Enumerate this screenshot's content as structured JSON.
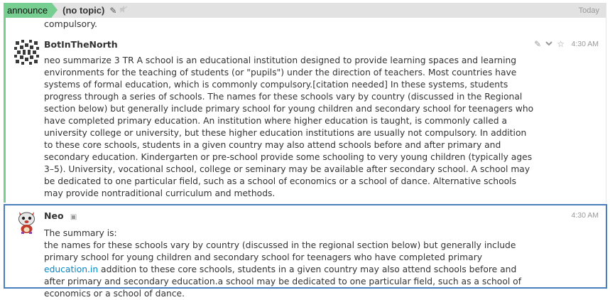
{
  "recipient": {
    "stream": "announce",
    "topic": "(no topic)",
    "date": "Today"
  },
  "messages": [
    {
      "continuation_text": "compulsory."
    },
    {
      "sender": "BotInTheNorth",
      "time": "4:30 AM",
      "body": "neo summarize 3 TR A school is an educational institution designed to provide learning spaces and learning environments for the teaching of students (or \"pupils\") under the direction of teachers. Most countries have systems of formal education, which is commonly compulsory.[citation needed] In these systems, students progress through a series of schools. The names for these schools vary by country (discussed in the Regional section below) but generally include primary school for young children and secondary school for teenagers who have completed primary education. An institution where higher education is taught, is commonly called a university college or university, but these higher education institutions are usually not compulsory. In addition to these core schools, students in a given country may also attend schools before and after primary and secondary education. Kindergarten or pre-school provide some schooling to very young children (typically ages 3–5). University, vocational school, college or seminary may be available after secondary school. A school may be dedicated to one particular field, such as a school of economics or a school of dance. Alternative schools may provide nontraditional curriculum and methods."
    },
    {
      "sender": "Neo",
      "time": "4:30 AM",
      "line1": "The summary is:",
      "body_before_link": "the names for these schools vary by country (discussed in the regional section below) but generally include primary school for young children and secondary school for teenagers who have completed primary ",
      "link_text": "education.in",
      "body_after_link": " addition to these core schools, students in a given country may also attend schools before and after primary and secondary education.a school may be dedicated to one particular field, such as a school of economics or a school of dance."
    }
  ],
  "icons": {
    "edit": "pencil-icon",
    "mute": "mute-icon",
    "chevron": "chevron-down-icon",
    "star": "star-icon",
    "bot": "bot-icon"
  },
  "colors": {
    "stream": "#76ce90",
    "selected_border": "#4a7fbd",
    "link": "#0088cc"
  }
}
